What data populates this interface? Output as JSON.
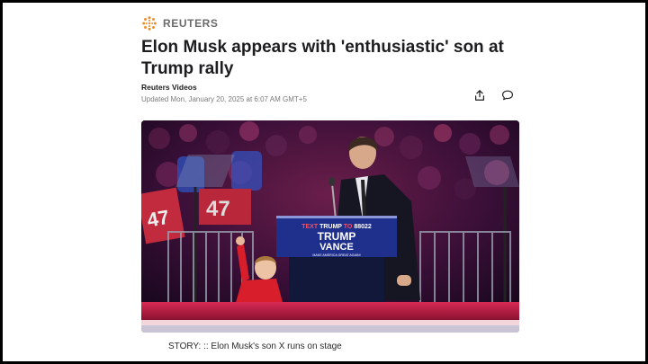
{
  "source": {
    "name": "REUTERS",
    "logo_icon": "reuters-logo-icon",
    "logo_color": "#f08a24"
  },
  "article": {
    "headline": "Elon Musk appears with 'enthusiastic' son at Trump rally",
    "byline": "Reuters Videos",
    "updated": "Updated Mon, January 20, 2025 at 6:07 AM GMT+5"
  },
  "actions": {
    "share_icon": "share-icon",
    "comment_icon": "comment-icon"
  },
  "video": {
    "lectern_line1_prefix": "TEXT ",
    "lectern_line1_highlight": "TRUMP",
    "lectern_line1_mid": " TO ",
    "lectern_line1_number": "88022",
    "lectern_line2": "TRUMP",
    "lectern_line3": "VANCE",
    "lectern_line4": "MAKE AMERICA GREAT AGAIN!",
    "crowd_sign_1": "47",
    "crowd_sign_2": "47",
    "colors": {
      "stage_glow": "#c0245a",
      "lectern_blue": "#1f2f8c",
      "lectern_red": "#d4202f"
    }
  },
  "caption": "STORY: :: Elon Musk's son X runs on stage"
}
